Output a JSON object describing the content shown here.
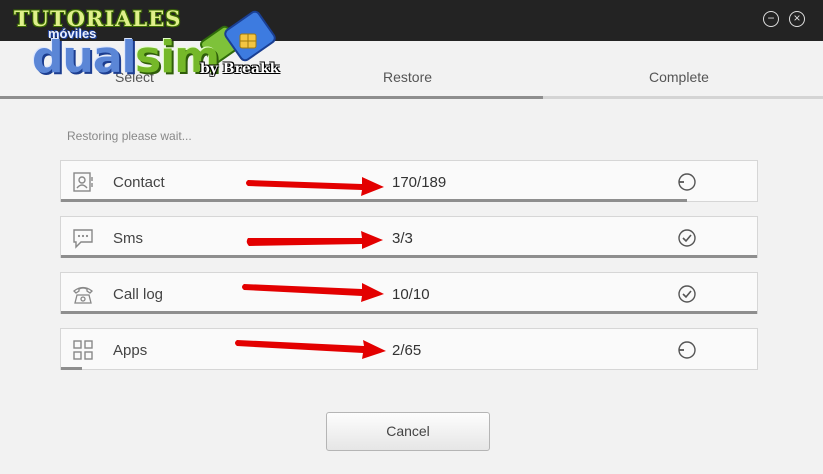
{
  "logo": {
    "line1": "TUTORIALES",
    "line2": "móviles",
    "dual": "dual",
    "sim": "sim",
    "by": "by Breakk"
  },
  "window": {
    "minimize_label": "−",
    "close_label": "×"
  },
  "steps": [
    {
      "label": "Select"
    },
    {
      "label": "Restore"
    },
    {
      "label": "Complete"
    }
  ],
  "wizard_progress": 0.66,
  "status_text": "Restoring please wait...",
  "items": [
    {
      "label": "Contact",
      "count": "170/189",
      "state": "in-progress",
      "progress": 0.9,
      "icon": "contact-card-icon"
    },
    {
      "label": "Sms",
      "count": "3/3",
      "state": "done",
      "progress": 1.0,
      "icon": "chat-bubble-icon"
    },
    {
      "label": "Call log",
      "count": "10/10",
      "state": "done",
      "progress": 1.0,
      "icon": "telephone-icon"
    },
    {
      "label": "Apps",
      "count": "2/65",
      "state": "in-progress",
      "progress": 0.03,
      "icon": "apps-grid-icon"
    }
  ],
  "cancel_label": "Cancel",
  "colors": {
    "titlebar": "#232323",
    "arrow": "#e30000",
    "progress": "#8e8e8e"
  }
}
